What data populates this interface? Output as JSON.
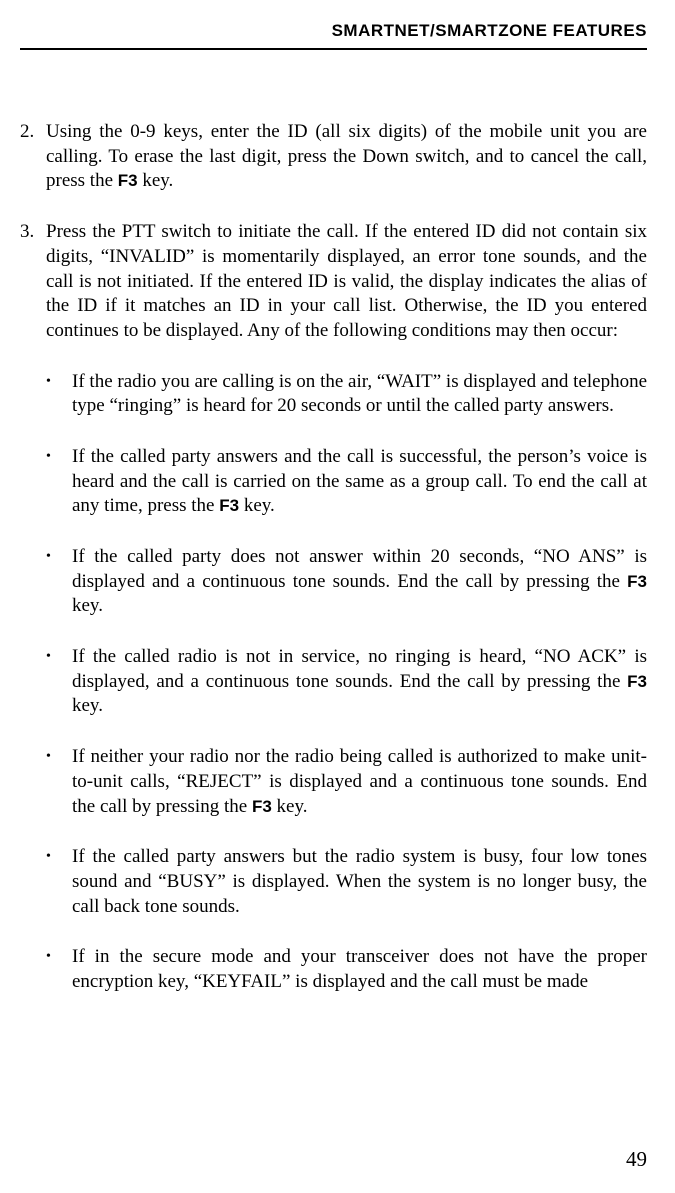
{
  "header": "SMARTNET/SMARTZONE FEATURES",
  "items": [
    {
      "num": "2.",
      "segments": [
        {
          "text": "Using the 0-9 keys, enter the ID (all six digits) of the mobile unit you are calling. To erase the last digit, press the Down switch, and to cancel the call, press the "
        },
        {
          "text": "F3",
          "bold": true
        },
        {
          "text": " key."
        }
      ]
    },
    {
      "num": "3.",
      "segments": [
        {
          "text": "Press the PTT switch to initiate the call. If the entered ID did not contain six digits, “INVALID” is momentarily displayed, an error tone sounds, and the call is not initiated. If the entered ID is valid, the display indicates the alias of the ID if it matches an ID in your call list. Otherwise, the ID you entered continues to be displayed. Any of the following conditions may then occur:"
        }
      ]
    }
  ],
  "bullets": [
    {
      "segments": [
        {
          "text": "If the radio you are calling is on the air, “WAIT” is displayed and telephone type “ringing” is heard for 20 seconds or until the called party answers."
        }
      ]
    },
    {
      "segments": [
        {
          "text": "If the called party answers and the call is successful, the person’s voice is heard and the call is carried on the same as a group call. To end the call at any time, press the "
        },
        {
          "text": "F3",
          "bold": true
        },
        {
          "text": " key."
        }
      ]
    },
    {
      "segments": [
        {
          "text": "If the called party does not answer within 20 seconds, “NO ANS” is displayed and a continuous tone sounds. End the call by pressing the "
        },
        {
          "text": "F3",
          "bold": true
        },
        {
          "text": " key."
        }
      ]
    },
    {
      "segments": [
        {
          "text": "If the called radio is not in service, no ringing is heard, “NO ACK” is displayed, and a continuous tone sounds. End the call by pressing the "
        },
        {
          "text": "F3",
          "bold": true
        },
        {
          "text": " key."
        }
      ]
    },
    {
      "segments": [
        {
          "text": "If neither your radio nor the radio being called is authorized to make unit-to-unit calls, “REJECT” is displayed and a continuous tone sounds. End the call by pressing the "
        },
        {
          "text": "F3",
          "bold": true
        },
        {
          "text": " key."
        }
      ]
    },
    {
      "segments": [
        {
          "text": "If the called party answers but the radio system is busy, four low tones sound and “BUSY” is displayed. When the system is no longer busy, the call back tone sounds."
        }
      ]
    },
    {
      "segments": [
        {
          "text": "If in the secure mode and your transceiver does not have the proper encryption key, “KEYFAIL” is displayed and the call must be made"
        }
      ]
    }
  ],
  "pageNumber": "49"
}
